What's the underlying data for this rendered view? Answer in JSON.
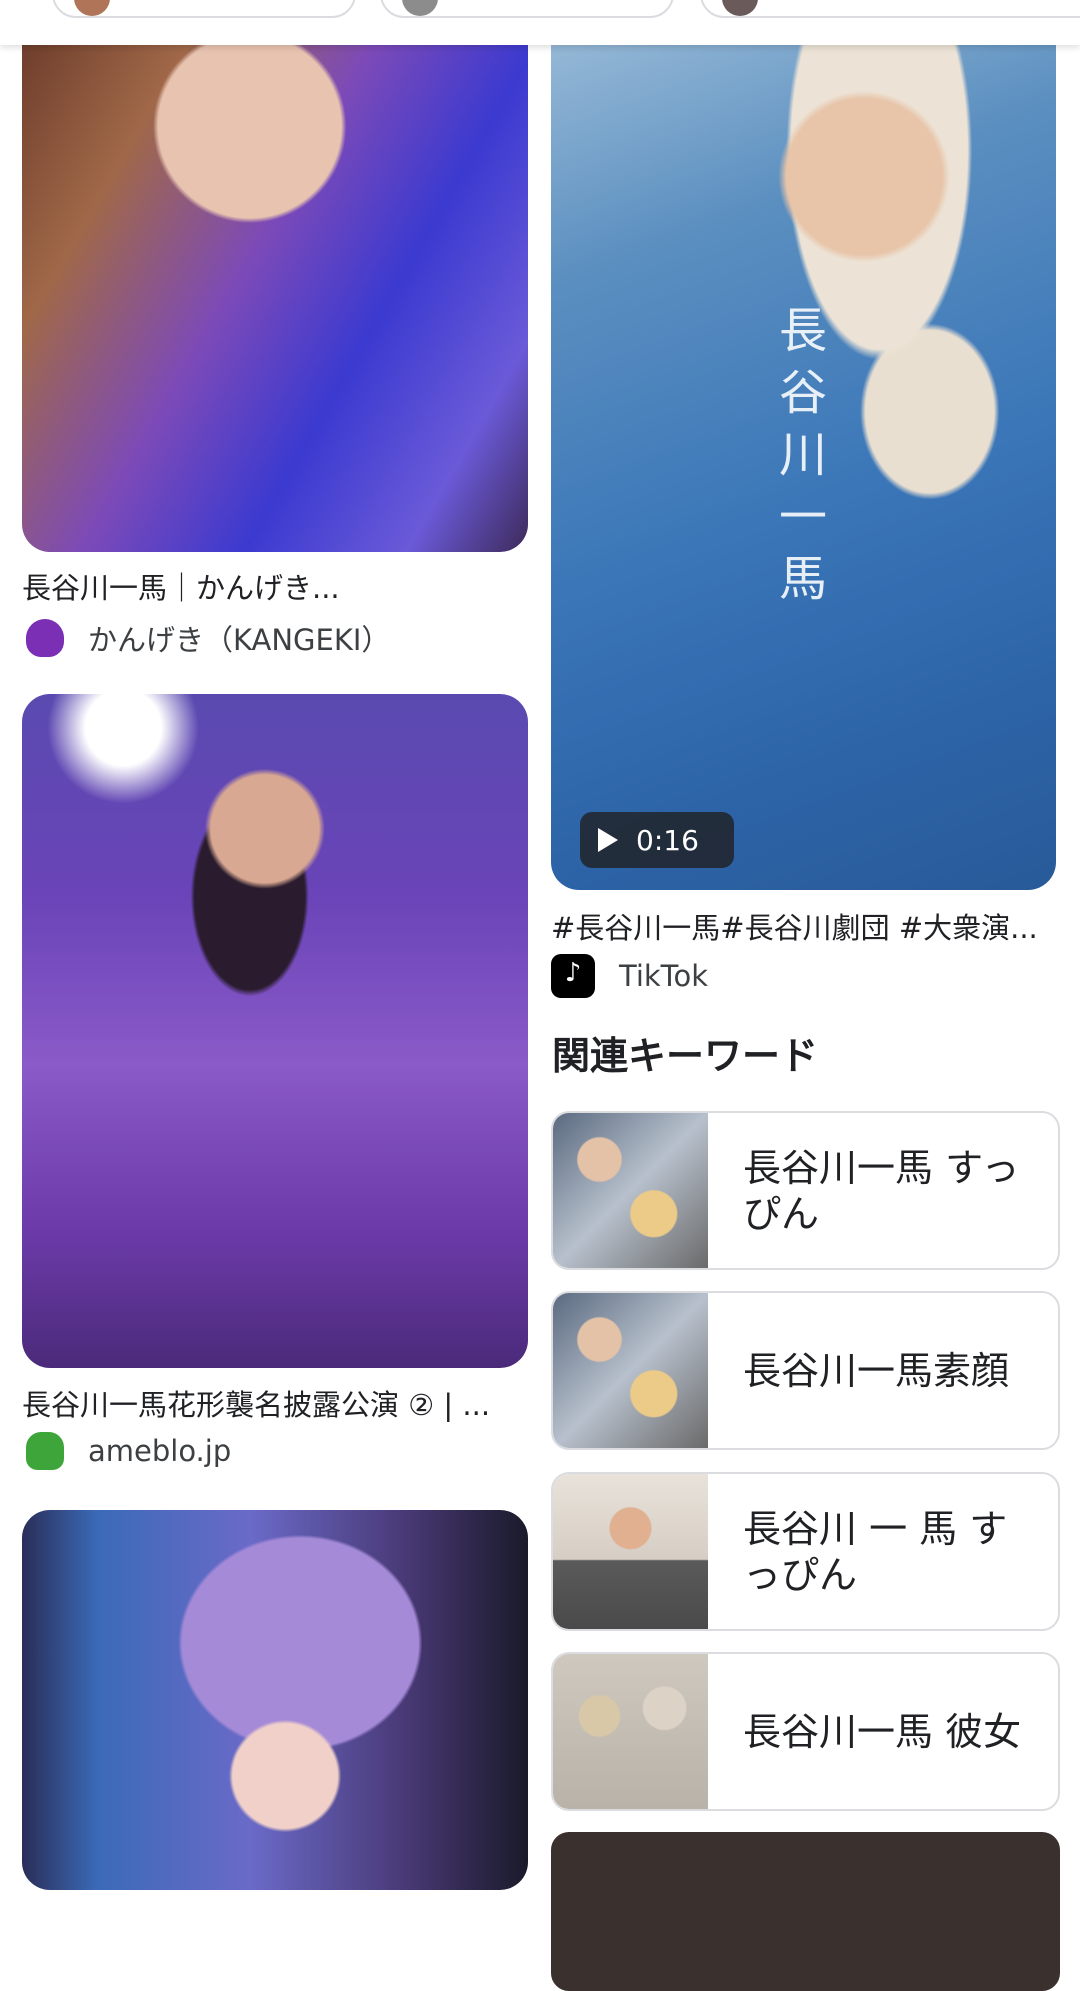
{
  "results": [
    {
      "caption": "長谷川一馬｜かんげき...",
      "source": "かんげき（KANGEKI）",
      "favicon": "kangeki-icon"
    },
    {
      "caption": "#長谷川一馬#長谷川劇団 #大衆演...",
      "source": "TikTok",
      "favicon": "tiktok-icon",
      "duration": "0:16",
      "overlay_text": "長谷川一馬"
    },
    {
      "caption": "長谷川一馬花形襲名披露公演 ② | ...",
      "source": "ameblo.jp",
      "favicon": "ameblo-icon"
    }
  ],
  "related": {
    "title": "関連キーワード",
    "items": [
      {
        "label": "長谷川一馬 すっぴん"
      },
      {
        "label": "長谷川一馬素顔"
      },
      {
        "label": "長谷川 一 馬 すっぴん"
      },
      {
        "label": "長谷川一馬 彼女"
      }
    ]
  },
  "colors": {
    "tiktok": "#000000",
    "ameblo": "#3ea53a",
    "kangeki": "#7b2fb5",
    "video_badge": "#202124"
  }
}
